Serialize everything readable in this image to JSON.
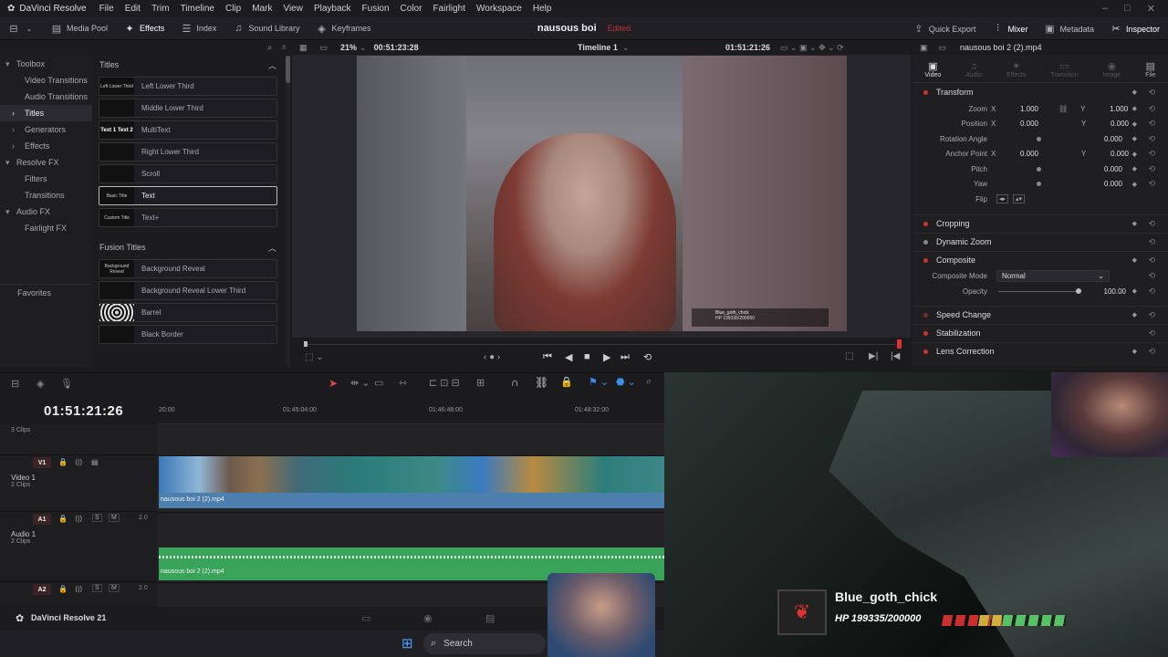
{
  "app": {
    "name": "DaVinci Resolve"
  },
  "menu": [
    "File",
    "Edit",
    "Trim",
    "Timeline",
    "Clip",
    "Mark",
    "View",
    "Playback",
    "Fusion",
    "Color",
    "Fairlight",
    "Workspace",
    "Help"
  ],
  "toolbar": {
    "left": [
      "Media Pool",
      "Effects",
      "Index",
      "Sound Library",
      "Keyframes"
    ],
    "project_title": "nausous boi",
    "edited": "Edited",
    "right": [
      "Quick Export",
      "Mixer",
      "Metadata",
      "Inspector"
    ]
  },
  "viewer": {
    "zoom": "21%",
    "timecode_left": "00:51:23:28",
    "timeline_name": "Timeline 1",
    "timecode_right": "01:51:21:26",
    "clip_name": "nausous boi 2 (2).mp4"
  },
  "sidebar": {
    "items": [
      {
        "label": "Toolbox",
        "arrow": "▾"
      },
      {
        "label": "Video Transitions",
        "arrow": ""
      },
      {
        "label": "Audio Transitions",
        "arrow": ""
      },
      {
        "label": "Titles",
        "arrow": "›"
      },
      {
        "label": "Generators",
        "arrow": "›"
      },
      {
        "label": "Effects",
        "arrow": "›"
      },
      {
        "label": "Resolve FX",
        "arrow": "▾"
      },
      {
        "label": "Filters",
        "arrow": ""
      },
      {
        "label": "Transitions",
        "arrow": ""
      },
      {
        "label": "Audio FX",
        "arrow": "▾"
      },
      {
        "label": "Fairlight FX",
        "arrow": ""
      }
    ],
    "favorites": "Favorites"
  },
  "titles": {
    "header": "Titles",
    "items": [
      {
        "thumb": "Left Lower Third",
        "label": "Left Lower Third"
      },
      {
        "thumb": "",
        "label": "Middle Lower Third"
      },
      {
        "thumb": "Text 1 Text 2",
        "label": "MultiText"
      },
      {
        "thumb": "",
        "label": "Right Lower Third"
      },
      {
        "thumb": "",
        "label": "Scroll"
      },
      {
        "thumb": "Basic Title",
        "label": "Text"
      },
      {
        "thumb": "Custom Title",
        "label": "Text+"
      }
    ]
  },
  "fusion_titles": {
    "header": "Fusion Titles",
    "items": [
      {
        "thumb": "Background Reveal",
        "label": "Background Reveal"
      },
      {
        "thumb": "",
        "label": "Background Reveal Lower Third"
      },
      {
        "thumb": "",
        "label": "Barrel"
      },
      {
        "thumb": "",
        "label": "Black Border"
      }
    ]
  },
  "inspector": {
    "clip": "nausous boi 2 (2).mp4",
    "tabs": [
      "Video",
      "Audio",
      "Effects",
      "Transition",
      "Image",
      "File"
    ],
    "transform": {
      "title": "Transform",
      "zoom_label": "Zoom",
      "zoom_x": "1.000",
      "zoom_y": "1.000",
      "pos_label": "Position",
      "pos_x": "0.000",
      "pos_y": "0.000",
      "rot_label": "Rotation Angle",
      "rot": "0.000",
      "anchor_label": "Anchor Point",
      "anchor_x": "0.000",
      "anchor_y": "0.000",
      "pitch_label": "Pitch",
      "pitch": "0.000",
      "yaw_label": "Yaw",
      "yaw": "0.000",
      "flip_label": "Flip"
    },
    "sections": [
      "Cropping",
      "Dynamic Zoom",
      "Composite",
      "Speed Change",
      "Stabilization",
      "Lens Correction"
    ],
    "composite_mode_label": "Composite Mode",
    "composite_mode": "Normal",
    "opacity_label": "Opacity",
    "opacity": "100.00"
  },
  "timeline": {
    "timecode": "01:51:21:26",
    "ruler": [
      "20:00",
      "01:45:04:00",
      "01:46:48:00",
      "01:48:32:00"
    ],
    "tracks": [
      {
        "badge": "",
        "name": "",
        "clips": "3 Clips"
      },
      {
        "badge": "V1",
        "name": "Video 1",
        "clips": "2 Clips",
        "clip": "nausous boi 2 (2).mp4"
      },
      {
        "badge": "A1",
        "name": "Audio 1",
        "clips": "2 Clips",
        "clip": "nausous boi 2 (2).mp4",
        "vol": "2.0"
      },
      {
        "badge": "A2",
        "name": "",
        "clips": "",
        "vol": "2.0"
      }
    ],
    "solo": "S",
    "mute": "M"
  },
  "status": {
    "app_version": "DaVinci Resolve 21"
  },
  "taskbar": {
    "search": "Search"
  },
  "overlay": {
    "name": "Blue_goth_chick",
    "hp": "HP 199335/200000",
    "name_small": "Blue_goth_chick",
    "hp_small": "HP 199335/200000"
  },
  "colors": {
    "accent": "#e04848",
    "video_track": "#4d7fae",
    "audio_track": "#3aa35a",
    "panel": "#1f1f22"
  }
}
